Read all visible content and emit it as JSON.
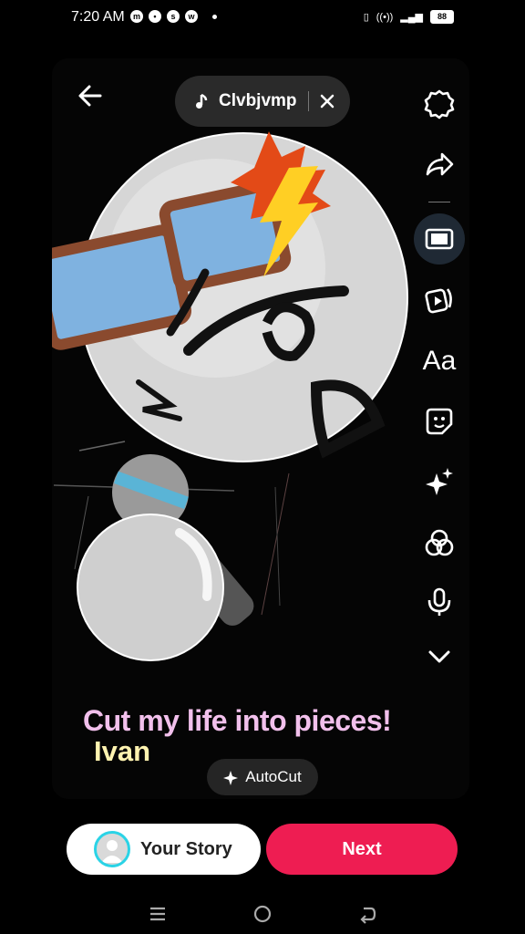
{
  "status": {
    "time": "7:20 AM",
    "battery": "88",
    "left_icons": [
      "messenger-icon",
      "chat-icon",
      "snapchat-icon",
      "wifi-calling-icon"
    ],
    "right_icons": [
      "vibrate-icon",
      "hotspot-icon",
      "signal-icon"
    ]
  },
  "music": {
    "title": "Clvbjvmp"
  },
  "toolbar": {
    "items": [
      "settings",
      "share",
      "crop",
      "templates",
      "text",
      "stickers",
      "effects",
      "filters",
      "voice",
      "more"
    ],
    "text_label": "Aa"
  },
  "captions": {
    "line1": "Cut my life into pieces!",
    "line2": "Ivan"
  },
  "autocut": {
    "label": "AutoCut"
  },
  "bottom": {
    "your_story": "Your Story",
    "next": "Next"
  },
  "colors": {
    "accent": "#ee1d52",
    "caption1": "#f2c0ec",
    "caption2": "#fff3b0",
    "avatar_ring": "#2ad3e6"
  }
}
